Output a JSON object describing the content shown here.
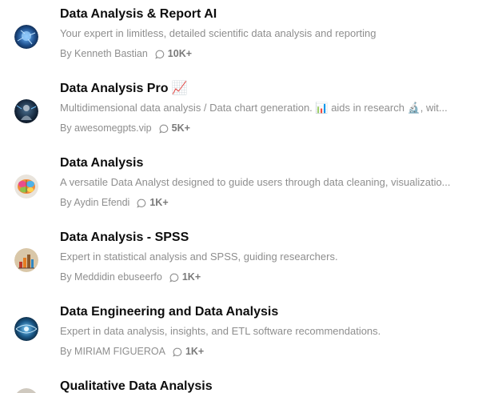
{
  "items": [
    {
      "title": "Data Analysis & Report AI",
      "emoji": "",
      "description": "Your expert in limitless, detailed scientific data analysis and reporting",
      "author": "By Kenneth Bastian",
      "count": "10K+",
      "avatar_icon": "blue-circuit-avatar-icon"
    },
    {
      "title": "Data Analysis Pro",
      "emoji": "📈",
      "description": "Multidimensional data analysis / Data chart generation. 📊 aids in research 🔬, wit...",
      "author": "By awesomegpts.vip",
      "count": "5K+",
      "avatar_icon": "tech-figure-avatar-icon"
    },
    {
      "title": "Data Analysis",
      "emoji": "",
      "description": "A versatile Data Analyst designed to guide users through data cleaning, visualizatio...",
      "author": "By Aydin Efendi",
      "count": "1K+",
      "avatar_icon": "colorful-brain-avatar-icon"
    },
    {
      "title": "Data Analysis - SPSS",
      "emoji": "",
      "description": "Expert in statistical analysis and SPSS, guiding researchers.",
      "author": "By Meddidin ebuseerfo",
      "count": "1K+",
      "avatar_icon": "bar-chart-avatar-icon"
    },
    {
      "title": "Data Engineering and Data Analysis",
      "emoji": "",
      "description": "Expert in data analysis, insights, and ETL software recommendations.",
      "author": "By MIRIAM FIGUEROA",
      "count": "1K+",
      "avatar_icon": "network-avatar-icon"
    },
    {
      "title": "Qualitative Data Analysis",
      "emoji": "",
      "description": "",
      "author": "",
      "count": "",
      "avatar_icon": "qualitative-avatar-icon"
    }
  ],
  "colors": {
    "title": "#0d0d0d",
    "secondary_text": "#8e8e8e"
  }
}
